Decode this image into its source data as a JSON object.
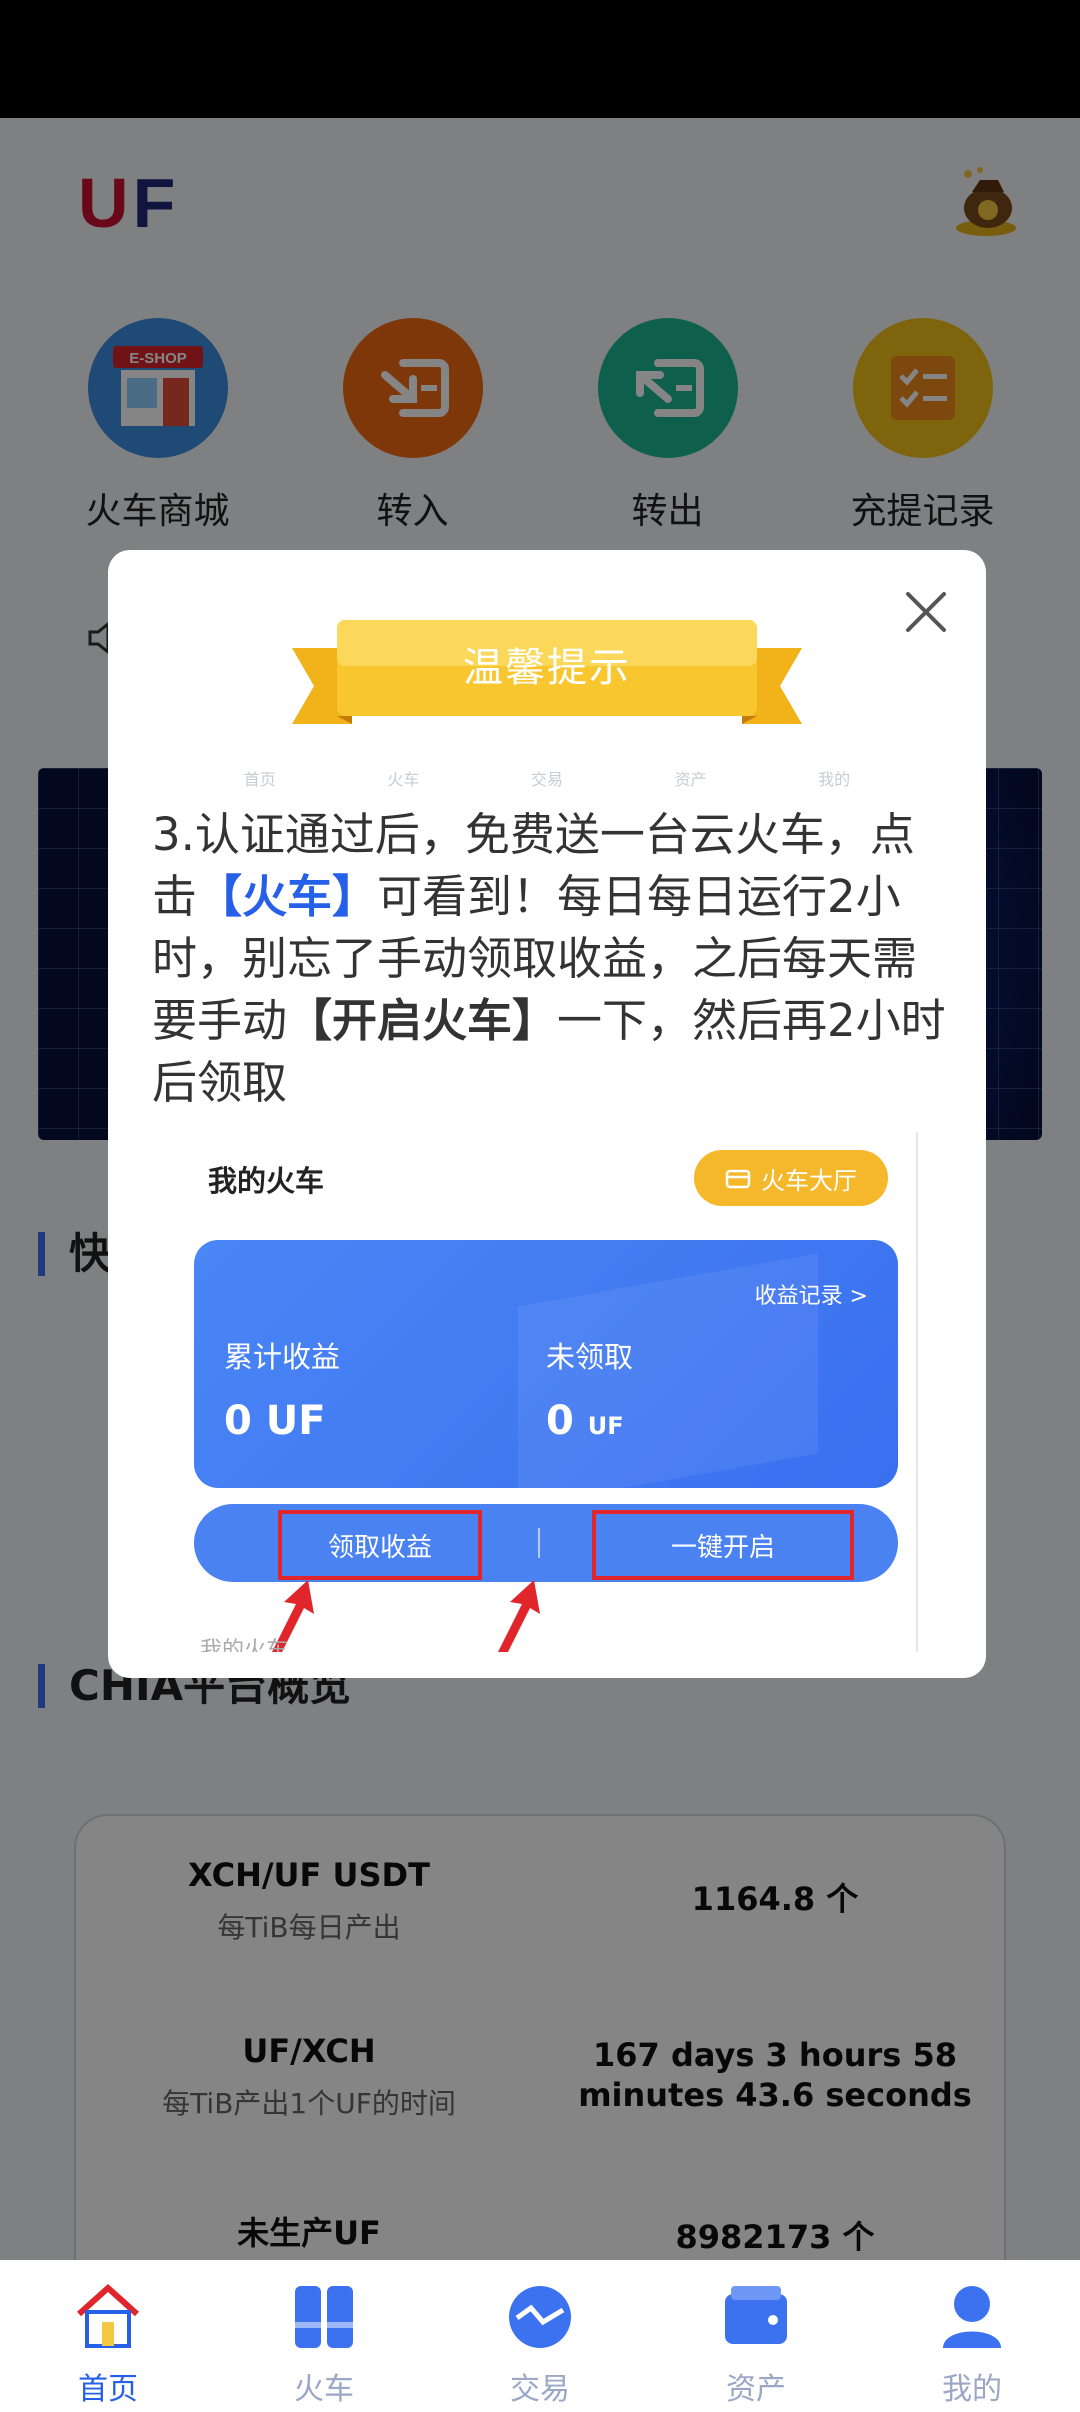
{
  "app": {
    "logo_text_u": "U",
    "logo_text_f": "F"
  },
  "quick_actions": [
    {
      "label": "火车商城",
      "icon": "eshop-icon",
      "badge": "E-SHOP"
    },
    {
      "label": "转入",
      "icon": "transfer-in-icon"
    },
    {
      "label": "转出",
      "icon": "transfer-out-icon"
    },
    {
      "label": "充提记录",
      "icon": "records-icon"
    }
  ],
  "sections": {
    "quick_prefix": "快",
    "overview_title": "CHIA平台概览"
  },
  "overview": [
    {
      "name": "XCH/UF USDT",
      "sub": "每TiB每日产出",
      "value": "1164.8 个"
    },
    {
      "name": "UF/XCH",
      "sub": "每TiB产出1个UF的时间",
      "value": "167 days 3 hours 58 minutes 43.6 seconds"
    },
    {
      "name": "未生产UF",
      "sub": "",
      "value": "8982173 个"
    }
  ],
  "tabs": [
    {
      "label": "首页",
      "icon": "home-icon",
      "active": true
    },
    {
      "label": "火车",
      "icon": "train-icon",
      "active": false
    },
    {
      "label": "交易",
      "icon": "trade-icon",
      "active": false
    },
    {
      "label": "资产",
      "icon": "wallet-icon",
      "active": false
    },
    {
      "label": "我的",
      "icon": "profile-icon",
      "active": false
    }
  ],
  "dialog": {
    "title": "温馨提示",
    "ghost_tabs": [
      "首页",
      "火车",
      "交易",
      "资产",
      "我的"
    ],
    "text_part1": "3.认证通过后，免费送一台云火车，点击",
    "text_hl": "【火车】",
    "text_part2": "可看到！每日每日运行2小时，别忘了手动领取收益，之后每天需要手动",
    "text_bold": "【开启火车】",
    "text_part3": "一下，然后再2小时后领取",
    "screenshot": {
      "title": "我的火车",
      "hall_button": "火车大厅",
      "records_link": "收益记录 >",
      "label_total": "累计收益",
      "label_unclaimed": "未领取",
      "value_total": "0 UF",
      "value_unclaimed": "0",
      "value_unclaimed_unit": "UF",
      "btn_claim": "领取收益",
      "btn_start": "一键开启",
      "under_text": "我的火车"
    }
  },
  "colors": {
    "accent": "#2760e8",
    "brand_red": "#c8102e",
    "highlight_red": "#e0262b"
  }
}
